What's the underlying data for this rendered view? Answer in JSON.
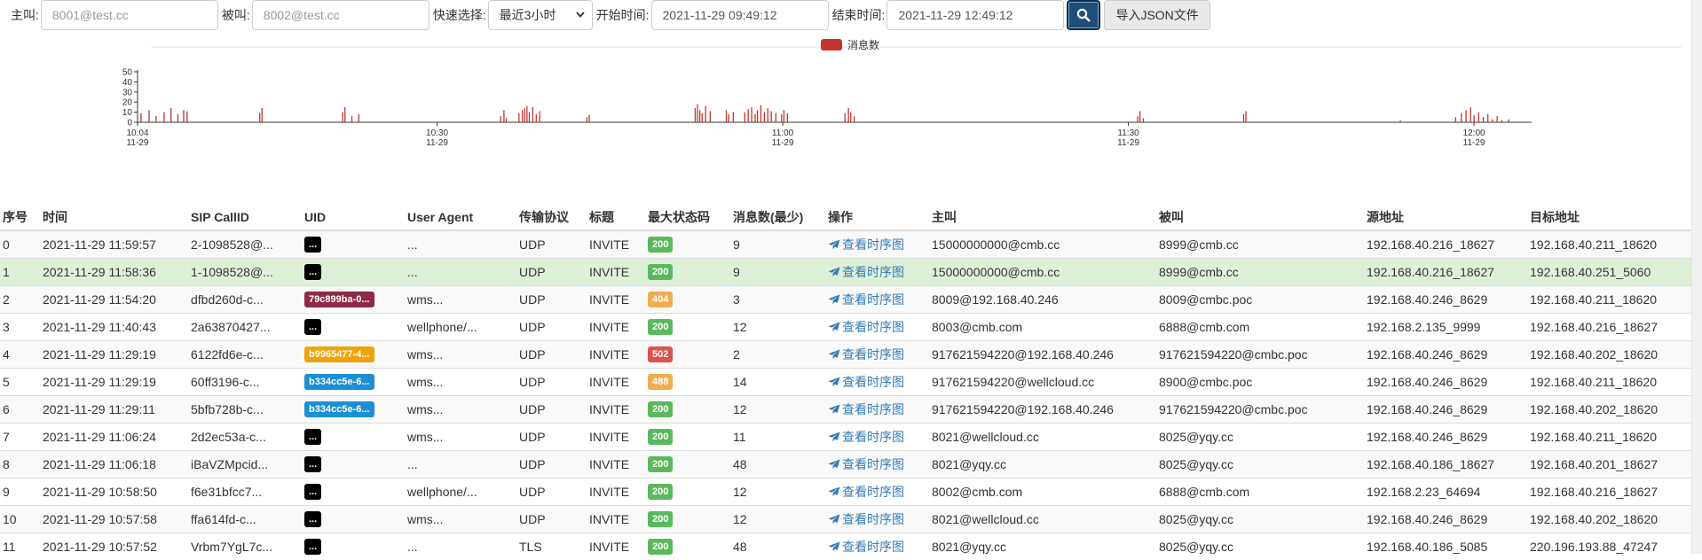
{
  "search": {
    "caller_label": "主叫:",
    "caller_placeholder": "8001@test.cc",
    "callee_label": "被叫:",
    "callee_placeholder": "8002@test.cc",
    "quick_label": "快速选择:",
    "quick_value": "最近3小时",
    "start_label": "开始时间:",
    "start_value": "2021-11-29 09:49:12",
    "end_label": "结束时间:",
    "end_value": "2021-11-29 12:49:12",
    "search_icon": "search-icon",
    "import_label": "导入JSON文件"
  },
  "chart_data": {
    "type": "bar",
    "legend": "消息数",
    "legend_position": "top-center",
    "color": "#c23531",
    "y_ticks": [
      0,
      10,
      20,
      30,
      40,
      50
    ],
    "ylim": [
      0,
      50
    ],
    "x_ticks": [
      {
        "time": "10:04",
        "date": "11-29"
      },
      {
        "time": "10:30",
        "date": "11-29"
      },
      {
        "time": "11:00",
        "date": "11-29"
      },
      {
        "time": "11:30",
        "date": "11-29"
      },
      {
        "time": "12:00",
        "date": "11-29"
      }
    ],
    "x_range_minutes": [
      0,
      121
    ],
    "points": [
      [
        0.3,
        9
      ],
      [
        1.0,
        12
      ],
      [
        1.6,
        6
      ],
      [
        2.3,
        10
      ],
      [
        2.9,
        14
      ],
      [
        3.5,
        8
      ],
      [
        4.0,
        12
      ],
      [
        4.3,
        11
      ],
      [
        10.6,
        9
      ],
      [
        10.8,
        14
      ],
      [
        17.8,
        10
      ],
      [
        18.0,
        15
      ],
      [
        18.6,
        6
      ],
      [
        19.2,
        8
      ],
      [
        31.5,
        6
      ],
      [
        31.8,
        12
      ],
      [
        32.0,
        4
      ],
      [
        33.1,
        9
      ],
      [
        33.4,
        12
      ],
      [
        33.6,
        14
      ],
      [
        33.8,
        16
      ],
      [
        34.0,
        10
      ],
      [
        34.3,
        15
      ],
      [
        34.6,
        8
      ],
      [
        34.9,
        11
      ],
      [
        39.0,
        5
      ],
      [
        39.2,
        7
      ],
      [
        48.4,
        14
      ],
      [
        48.6,
        18
      ],
      [
        48.8,
        12
      ],
      [
        49.0,
        9
      ],
      [
        49.3,
        16
      ],
      [
        49.7,
        11
      ],
      [
        51.1,
        12
      ],
      [
        51.3,
        8
      ],
      [
        51.7,
        10
      ],
      [
        52.7,
        10
      ],
      [
        53.0,
        13
      ],
      [
        53.3,
        15
      ],
      [
        53.6,
        8
      ],
      [
        53.8,
        12
      ],
      [
        54.1,
        17
      ],
      [
        54.4,
        10
      ],
      [
        54.7,
        14
      ],
      [
        55.0,
        11
      ],
      [
        55.4,
        9
      ],
      [
        55.9,
        8
      ],
      [
        56.1,
        12
      ],
      [
        56.4,
        9
      ],
      [
        61.4,
        9
      ],
      [
        61.7,
        14
      ],
      [
        61.9,
        10
      ],
      [
        62.2,
        6
      ],
      [
        86.8,
        6
      ],
      [
        87.0,
        11
      ],
      [
        87.3,
        4
      ],
      [
        96.0,
        8
      ],
      [
        96.2,
        11
      ],
      [
        109.6,
        2
      ],
      [
        114.4,
        5
      ],
      [
        114.9,
        9
      ],
      [
        115.3,
        12
      ],
      [
        115.7,
        15
      ],
      [
        116.0,
        7
      ],
      [
        116.4,
        10
      ],
      [
        116.8,
        5
      ],
      [
        117.2,
        8
      ],
      [
        117.6,
        3
      ],
      [
        118.0,
        6
      ],
      [
        118.4,
        2
      ],
      [
        119.0,
        3
      ]
    ]
  },
  "table": {
    "headers": [
      "序号",
      "时间",
      "SIP CallID",
      "UID",
      "User Agent",
      "传输协议",
      "标题",
      "最大状态码",
      "消息数(最少)",
      "操作",
      "主叫",
      "被叫",
      "源地址",
      "目标地址"
    ],
    "link_label": "查看时序图",
    "rows": [
      {
        "idx": "0",
        "time": "2021-11-29 11:59:57",
        "callid": "2-1098528@...",
        "uid": "...",
        "uid_color": "#000000",
        "ua": "...",
        "proto": "UDP",
        "title": "INVITE",
        "status": "200",
        "status_color": "#5cb85c",
        "count": "9",
        "caller": "15000000000@cmb.cc",
        "callee": "8999@cmb.cc",
        "src": "192.168.40.216_18627",
        "dst": "192.168.40.211_18620"
      },
      {
        "idx": "1",
        "time": "2021-11-29 11:58:36",
        "callid": "1-1098528@...",
        "uid": "...",
        "uid_color": "#000000",
        "ua": "...",
        "proto": "UDP",
        "title": "INVITE",
        "status": "200",
        "status_color": "#5cb85c",
        "count": "9",
        "caller": "15000000000@cmb.cc",
        "callee": "8999@cmb.cc",
        "src": "192.168.40.216_18627",
        "dst": "192.168.40.251_5060"
      },
      {
        "idx": "2",
        "time": "2021-11-29 11:54:20",
        "callid": "dfbd260d-c...",
        "uid": "79c899ba-0...",
        "uid_color": "#8e2a45",
        "ua": "wms...",
        "proto": "UDP",
        "title": "INVITE",
        "status": "404",
        "status_color": "#f0ad4e",
        "count": "3",
        "caller": "8009@192.168.40.246",
        "callee": "8009@cmbc.poc",
        "src": "192.168.40.246_8629",
        "dst": "192.168.40.211_18620"
      },
      {
        "idx": "3",
        "time": "2021-11-29 11:40:43",
        "callid": "2a63870427...",
        "uid": "...",
        "uid_color": "#000000",
        "ua": "wellphone/...",
        "proto": "UDP",
        "title": "INVITE",
        "status": "200",
        "status_color": "#5cb85c",
        "count": "12",
        "caller": "8003@cmb.com",
        "callee": "6888@cmb.com",
        "src": "192.168.2.135_9999",
        "dst": "192.168.40.216_18627"
      },
      {
        "idx": "4",
        "time": "2021-11-29 11:29:19",
        "callid": "6122fd6e-c...",
        "uid": "b9965477-4...",
        "uid_color": "#f0a30a",
        "ua": "wms...",
        "proto": "UDP",
        "title": "INVITE",
        "status": "502",
        "status_color": "#d9534f",
        "count": "2",
        "caller": "917621594220@192.168.40.246",
        "callee": "917621594220@cmbc.poc",
        "src": "192.168.40.246_8629",
        "dst": "192.168.40.202_18620"
      },
      {
        "idx": "5",
        "time": "2021-11-29 11:29:19",
        "callid": "60ff3196-c...",
        "uid": "b334cc5e-6...",
        "uid_color": "#1b8fd6",
        "ua": "wms...",
        "proto": "UDP",
        "title": "INVITE",
        "status": "488",
        "status_color": "#f0ad4e",
        "count": "14",
        "caller": "917621594220@wellcloud.cc",
        "callee": "8900@cmbc.poc",
        "src": "192.168.40.246_8629",
        "dst": "192.168.40.211_18620"
      },
      {
        "idx": "6",
        "time": "2021-11-29 11:29:11",
        "callid": "5bfb728b-c...",
        "uid": "b334cc5e-6...",
        "uid_color": "#1b8fd6",
        "ua": "wms...",
        "proto": "UDP",
        "title": "INVITE",
        "status": "200",
        "status_color": "#5cb85c",
        "count": "12",
        "caller": "917621594220@192.168.40.246",
        "callee": "917621594220@cmbc.poc",
        "src": "192.168.40.246_8629",
        "dst": "192.168.40.202_18620"
      },
      {
        "idx": "7",
        "time": "2021-11-29 11:06:24",
        "callid": "2d2ec53a-c...",
        "uid": "...",
        "uid_color": "#000000",
        "ua": "wms...",
        "proto": "UDP",
        "title": "INVITE",
        "status": "200",
        "status_color": "#5cb85c",
        "count": "11",
        "caller": "8021@wellcloud.cc",
        "callee": "8025@yqy.cc",
        "src": "192.168.40.246_8629",
        "dst": "192.168.40.211_18620"
      },
      {
        "idx": "8",
        "time": "2021-11-29 11:06:18",
        "callid": "iBaVZMpcid...",
        "uid": "...",
        "uid_color": "#000000",
        "ua": "...",
        "proto": "UDP",
        "title": "INVITE",
        "status": "200",
        "status_color": "#5cb85c",
        "count": "48",
        "caller": "8021@yqy.cc",
        "callee": "8025@yqy.cc",
        "src": "192.168.40.186_18627",
        "dst": "192.168.40.201_18627"
      },
      {
        "idx": "9",
        "time": "2021-11-29 10:58:50",
        "callid": "f6e31bfcc7...",
        "uid": "...",
        "uid_color": "#000000",
        "ua": "wellphone/...",
        "proto": "UDP",
        "title": "INVITE",
        "status": "200",
        "status_color": "#5cb85c",
        "count": "12",
        "caller": "8002@cmb.com",
        "callee": "6888@cmb.com",
        "src": "192.168.2.23_64694",
        "dst": "192.168.40.216_18627"
      },
      {
        "idx": "10",
        "time": "2021-11-29 10:57:58",
        "callid": "ffa614fd-c...",
        "uid": "...",
        "uid_color": "#000000",
        "ua": "wms...",
        "proto": "UDP",
        "title": "INVITE",
        "status": "200",
        "status_color": "#5cb85c",
        "count": "12",
        "caller": "8021@wellcloud.cc",
        "callee": "8025@yqy.cc",
        "src": "192.168.40.246_8629",
        "dst": "192.168.40.202_18620"
      },
      {
        "idx": "11",
        "time": "2021-11-29 10:57:52",
        "callid": "Vrbm7YgL7c...",
        "uid": "...",
        "uid_color": "#000000",
        "ua": "...",
        "proto": "TLS",
        "title": "INVITE",
        "status": "200",
        "status_color": "#5cb85c",
        "count": "48",
        "caller": "8021@yqy.cc",
        "callee": "8025@yqy.cc",
        "src": "192.168.40.186_5085",
        "dst": "220.196.193.88_47247"
      }
    ]
  },
  "selected_row": 1
}
